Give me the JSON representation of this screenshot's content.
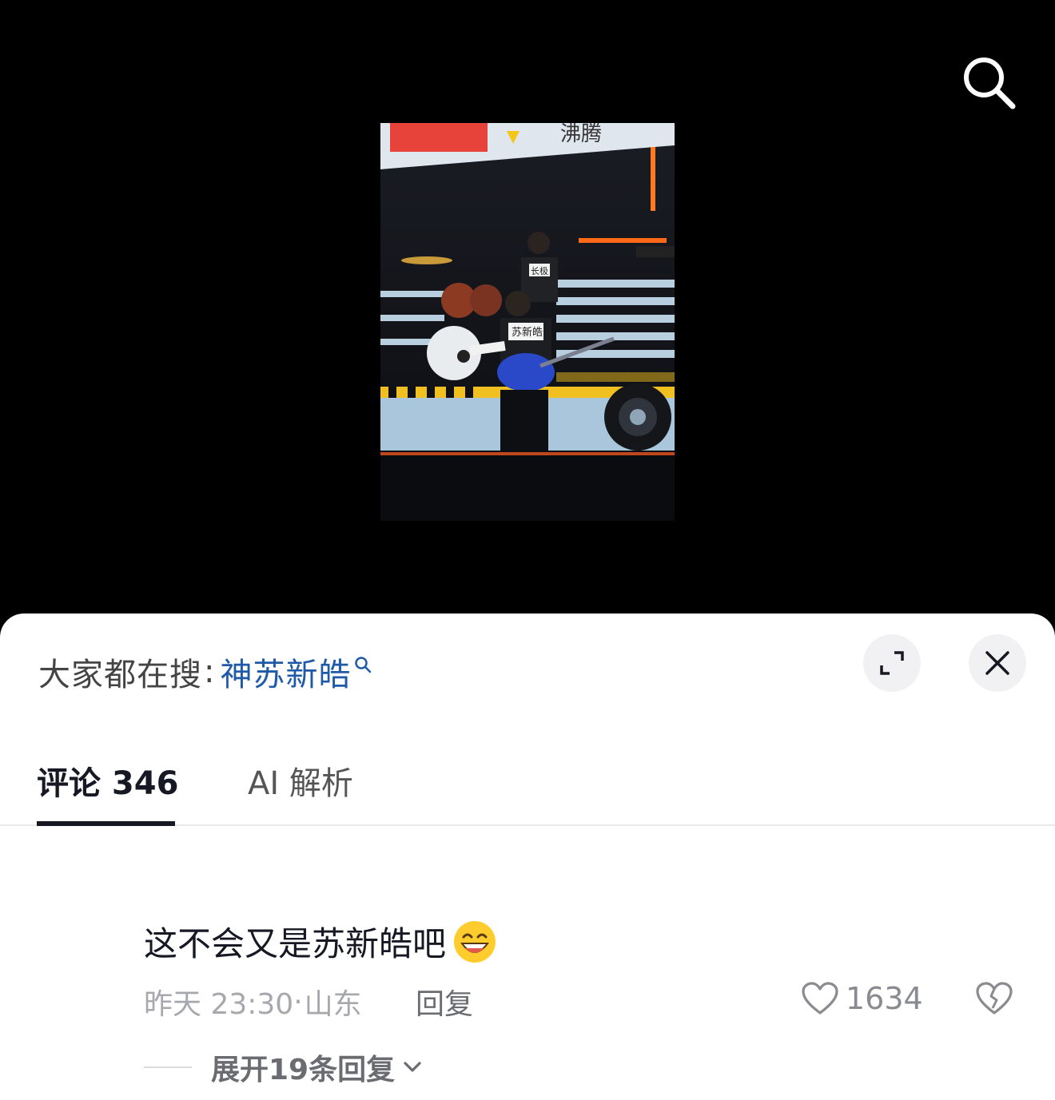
{
  "search_icon": "search-icon",
  "video": {
    "banner_text": "沸腾",
    "shirt_text": "苏新皓",
    "drummer_shirt_text": "长极"
  },
  "sheet": {
    "hot_search_prefix": "大家都在搜",
    "hot_search_colon": ":",
    "hot_search_term": "神苏新皓",
    "expand_icon": "expand-icon",
    "close_icon": "close-icon"
  },
  "tabs": [
    {
      "label": "评论 346",
      "active": true
    },
    {
      "label": "AI 解析",
      "active": false
    }
  ],
  "comment": {
    "text": "这不会又是苏新皓吧",
    "emoji": "grinning-face-emoji",
    "time": "昨天 23:30",
    "separator": "·",
    "location": "山东",
    "reply_label": "回复",
    "like_count": "1634",
    "expand_replies_label": "展开19条回复"
  },
  "colors": {
    "accent_link": "#1f5aa8",
    "text_primary": "#161823",
    "text_secondary": "#a7a8ad"
  }
}
